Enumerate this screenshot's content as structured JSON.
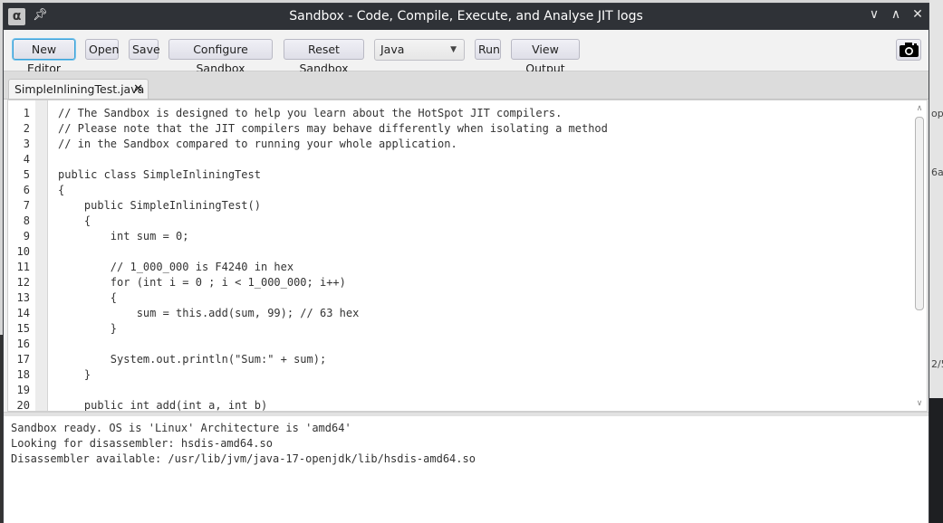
{
  "window": {
    "title": "Sandbox - Code, Compile, Execute, and Analyse JIT logs",
    "controls": [
      "minimize-icon",
      "maximize-icon",
      "close-icon"
    ]
  },
  "background": {
    "fragments": [
      "op",
      "6a",
      "2/5"
    ]
  },
  "toolbar": {
    "new_editor": "New Editor",
    "open": "Open",
    "save": "Save",
    "configure_sandbox": "Configure Sandbox",
    "reset_sandbox": "Reset Sandbox",
    "language_selected": "Java",
    "run": "Run",
    "view_output": "View Output",
    "snapshot_icon": "camera-icon"
  },
  "tabs": [
    {
      "label": "SimpleInliningTest.java",
      "close": "✕"
    }
  ],
  "editor": {
    "line_numbers": [
      "1",
      "2",
      "3",
      "4",
      "5",
      "6",
      "7",
      "8",
      "9",
      "10",
      "11",
      "12",
      "13",
      "14",
      "15",
      "16",
      "17",
      "18",
      "19",
      "20"
    ],
    "lines": [
      "// The Sandbox is designed to help you learn about the HotSpot JIT compilers.",
      "// Please note that the JIT compilers may behave differently when isolating a method",
      "// in the Sandbox compared to running your whole application.",
      "",
      "public class SimpleInliningTest",
      "{",
      "    public SimpleInliningTest()",
      "    {",
      "        int sum = 0;",
      "",
      "        // 1_000_000 is F4240 in hex",
      "        for (int i = 0 ; i < 1_000_000; i++)",
      "        {",
      "            sum = this.add(sum, 99); // 63 hex",
      "        }",
      "",
      "        System.out.println(\"Sum:\" + sum);",
      "    }",
      "",
      "    public int add(int a, int b)"
    ]
  },
  "console": {
    "lines": [
      "Sandbox ready. OS is 'Linux' Architecture is 'amd64'",
      "Looking for disassembler: hsdis-amd64.so",
      "Disassembler available: /usr/lib/jvm/java-17-openjdk/lib/hsdis-amd64.so"
    ]
  },
  "colors": {
    "titlebar": "#2f3237",
    "focus_ring": "#3aa0d6"
  }
}
